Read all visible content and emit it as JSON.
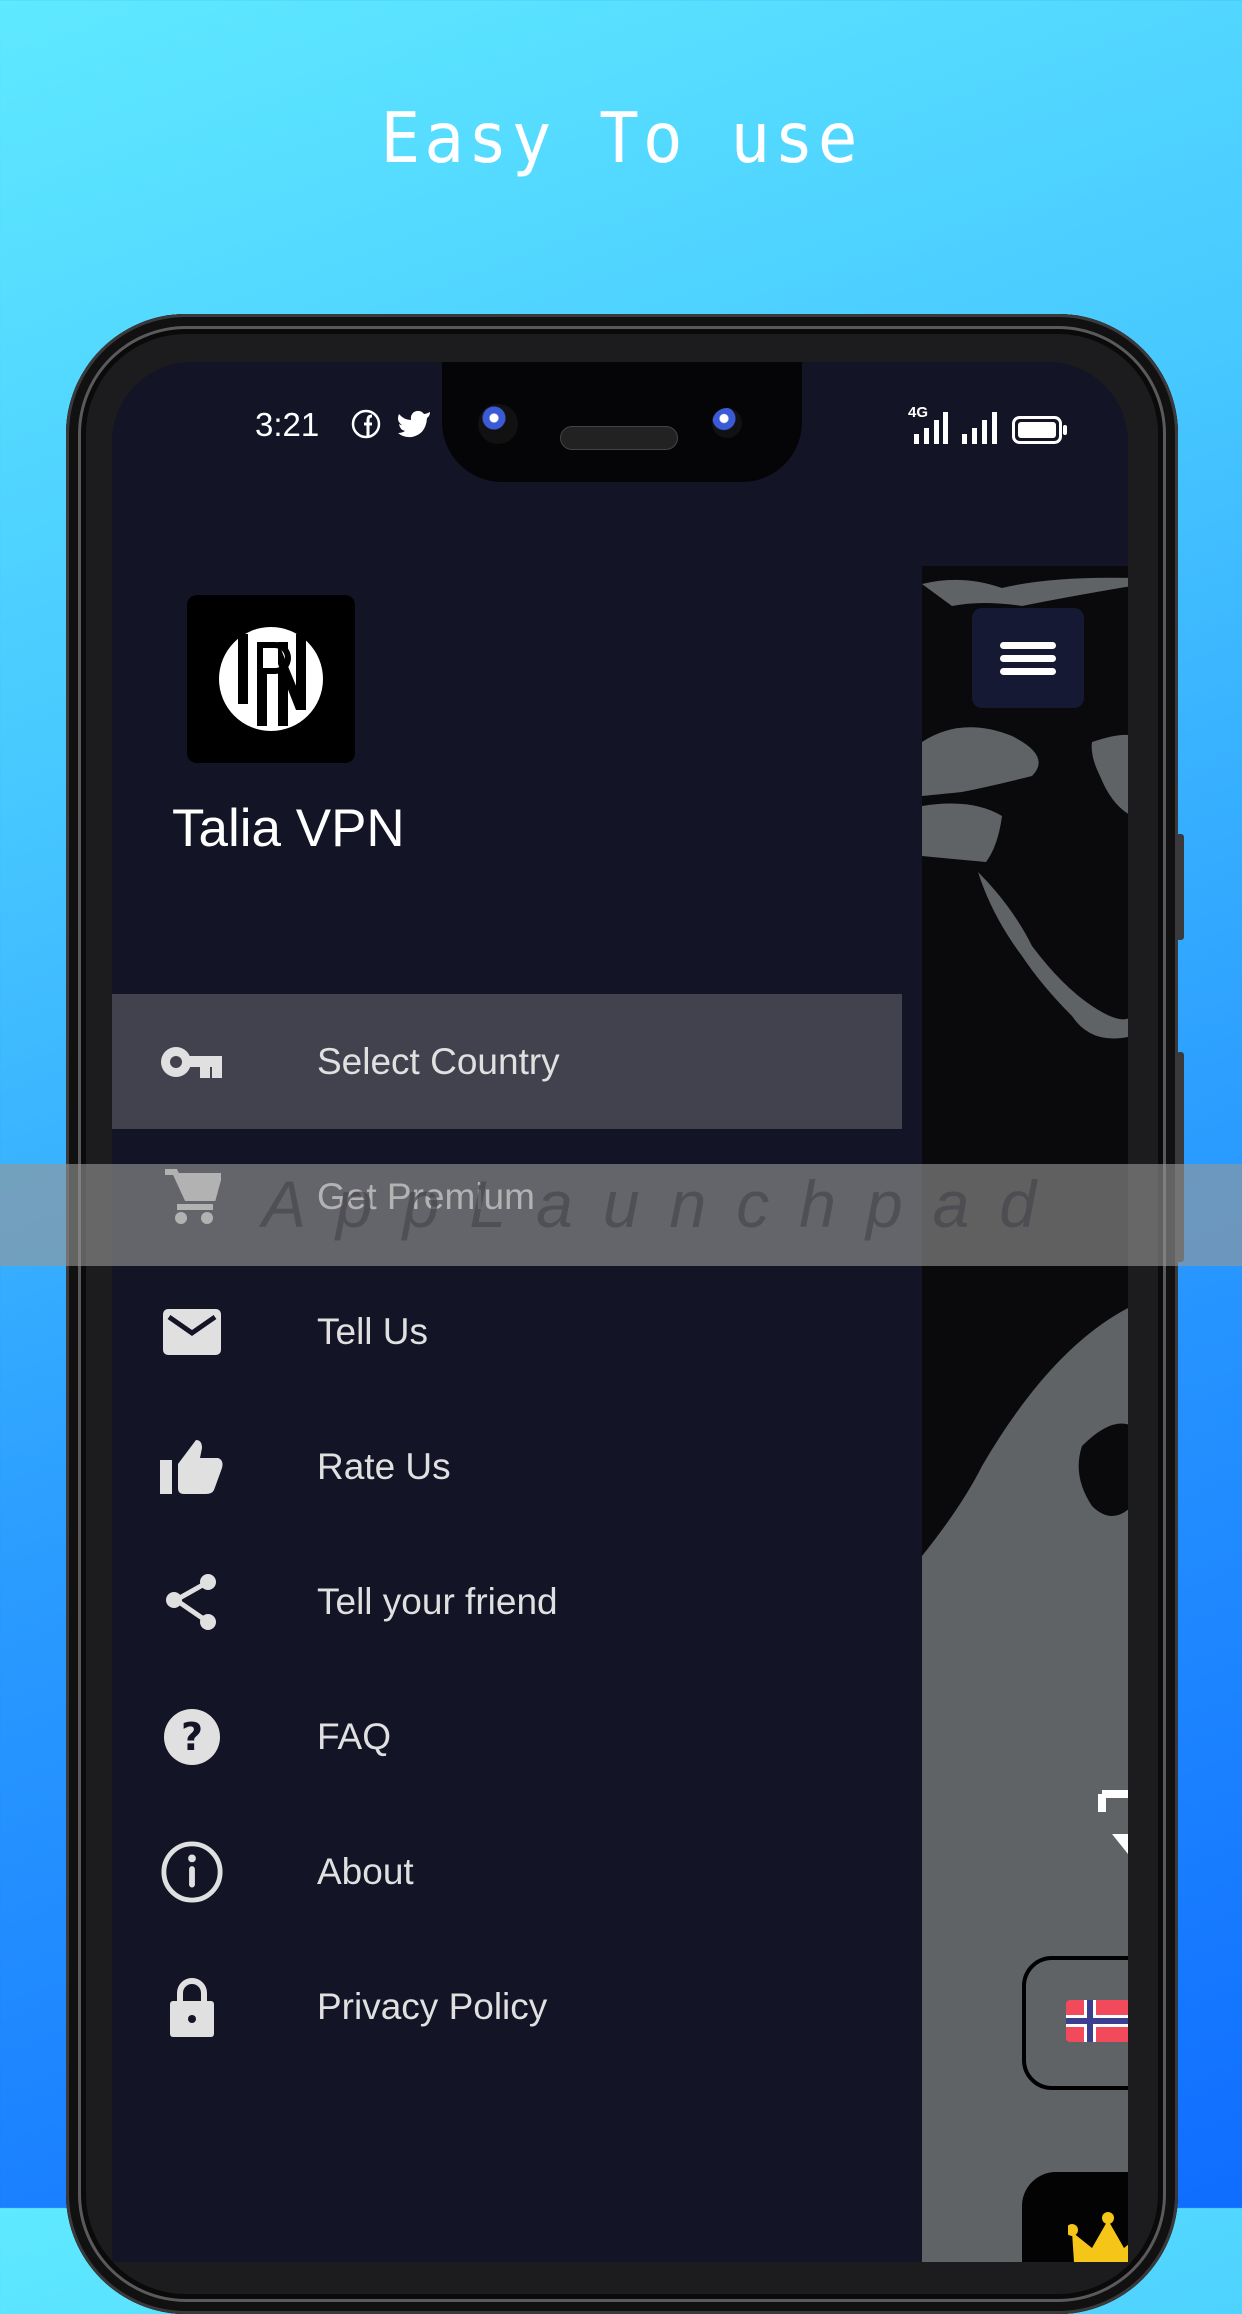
{
  "promo": {
    "headline": "Easy  To use"
  },
  "status_bar": {
    "time": "3:21",
    "notification_icons": [
      "facebook-icon",
      "twitter-icon"
    ],
    "network": "4G",
    "right_icons": [
      "signal-4g-icon",
      "signal-icon",
      "battery-icon"
    ]
  },
  "drawer": {
    "app_name": "Talia VPN",
    "logo_text": "VPN",
    "items": [
      {
        "label": "Select Country",
        "icon": "key-icon",
        "active": true
      },
      {
        "label": "Get Premium",
        "icon": "cart-icon",
        "active": false
      },
      {
        "label": "Tell Us",
        "icon": "mail-icon",
        "active": false
      },
      {
        "label": "Rate Us",
        "icon": "thumbs-up-icon",
        "active": false
      },
      {
        "label": "Tell your friend",
        "icon": "share-icon",
        "active": false
      },
      {
        "label": "FAQ",
        "icon": "help-icon",
        "active": false
      },
      {
        "label": "About",
        "icon": "info-icon",
        "active": false
      },
      {
        "label": "Privacy Policy",
        "icon": "lock-icon",
        "active": false
      }
    ]
  },
  "main": {
    "menu_button_icon": "hamburger-icon",
    "selected_country_flag": "Norway"
  },
  "watermark": {
    "text": "AppLaunchpad"
  },
  "colors": {
    "drawer_bg": "#131426",
    "active_item_bg": "#42424f",
    "menu_text": "#e0e0e0",
    "map_land": "#5f6366",
    "map_sea": "#0a0a0c",
    "crown": "#f5c518"
  }
}
